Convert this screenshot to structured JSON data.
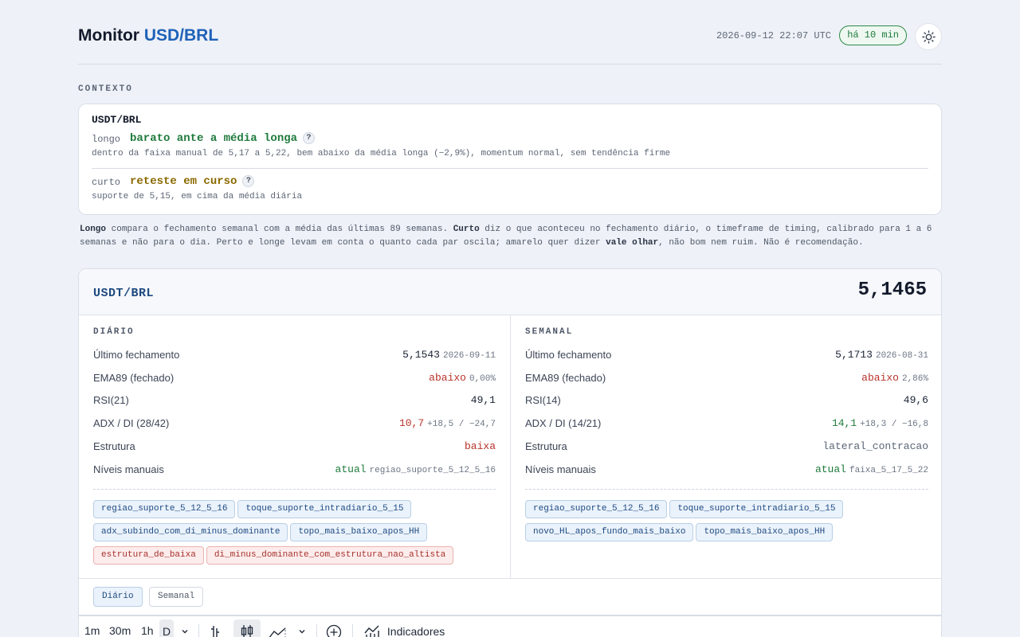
{
  "header": {
    "title_prefix": "Monitor",
    "title_pair": "USD/BRL",
    "timestamp": "2026-09-12 22:07 UTC",
    "freshness": "há 10 min",
    "theme_icon": "sun-icon"
  },
  "context": {
    "section_label": "CONTEXTO",
    "pair": "USDT/BRL",
    "long": {
      "label": "longo",
      "verdict": "barato ante a média longa",
      "help": "?",
      "description": "dentro da faixa manual de 5,17 a 5,22, bem abaixo da média longa (−2,9%), momentum normal, sem tendência firme"
    },
    "short": {
      "label": "curto",
      "verdict": "reteste em curso",
      "help": "?",
      "description": "suporte de 5,15, em cima da média diária"
    },
    "explanation": {
      "b1": "Longo",
      "t1": " compara o fechamento semanal com a média das últimas 89 semanas. ",
      "b2": "Curto",
      "t2": " diz o que aconteceu no fechamento diário, o timeframe de timing, calibrado para 1 a 6 semanas e não para o dia. Perto e longe levam em conta o quanto cada par oscila; amarelo quer dizer ",
      "b3": "vale olhar",
      "t3": ", não bom nem ruim. Não é recomendação."
    }
  },
  "card": {
    "pair": "USDT/BRL",
    "price": "5,1465",
    "daily": {
      "title": "DIÁRIO",
      "rows": [
        {
          "label": "Último fechamento",
          "value": "5,1543",
          "sub": "2026-09-11"
        },
        {
          "label": "EMA89 (fechado)",
          "value": "abaixo",
          "sub": "0,00%"
        },
        {
          "label": "RSI(21)",
          "value": "49,1",
          "sub": ""
        },
        {
          "label": "ADX / DI (28/42)",
          "value": "10,7",
          "sub": "+18,5 / −24,7"
        },
        {
          "label": "Estrutura",
          "value": "baixa",
          "sub": ""
        },
        {
          "label": "Níveis manuais",
          "value": "atual",
          "sub": "regiao_suporte_5_12_5_16"
        }
      ],
      "chips": [
        {
          "text": "regiao_suporte_5_12_5_16",
          "kind": "neutral"
        },
        {
          "text": "toque_suporte_intradiario_5_15",
          "kind": "neutral"
        },
        {
          "text": "adx_subindo_com_di_minus_dominante",
          "kind": "neutral"
        },
        {
          "text": "topo_mais_baixo_apos_HH",
          "kind": "neutral"
        },
        {
          "text": "estrutura_de_baixa",
          "kind": "bear"
        },
        {
          "text": "di_minus_dominante_com_estrutura_nao_altista",
          "kind": "bear"
        }
      ]
    },
    "weekly": {
      "title": "SEMANAL",
      "rows": [
        {
          "label": "Último fechamento",
          "value": "5,1713",
          "sub": "2026-08-31"
        },
        {
          "label": "EMA89 (fechado)",
          "value": "abaixo",
          "sub": "2,86%"
        },
        {
          "label": "RSI(14)",
          "value": "49,6",
          "sub": ""
        },
        {
          "label": "ADX / DI (14/21)",
          "value": "14,1",
          "sub": "+18,3 / −16,8"
        },
        {
          "label": "Estrutura",
          "value": "lateral_contracao",
          "sub": ""
        },
        {
          "label": "Níveis manuais",
          "value": "atual",
          "sub": "faixa_5_17_5_22"
        }
      ],
      "chips": [
        {
          "text": "regiao_suporte_5_12_5_16",
          "kind": "neutral"
        },
        {
          "text": "toque_suporte_intradiario_5_15",
          "kind": "neutral"
        },
        {
          "text": "novo_HL_apos_fundo_mais_baixo",
          "kind": "neutral"
        },
        {
          "text": "topo_mais_baixo_apos_HH",
          "kind": "neutral"
        }
      ]
    },
    "tabs": [
      "Diário",
      "Semanal"
    ],
    "chart_toolbar": {
      "intervals": [
        "1m",
        "30m",
        "1h",
        "D"
      ],
      "indicators_label": "Indicadores"
    }
  },
  "colors": {
    "accent": "#1f62b8",
    "positive": "#1f7a3c",
    "negative": "#b8322a",
    "amber": "#8a6a00"
  }
}
